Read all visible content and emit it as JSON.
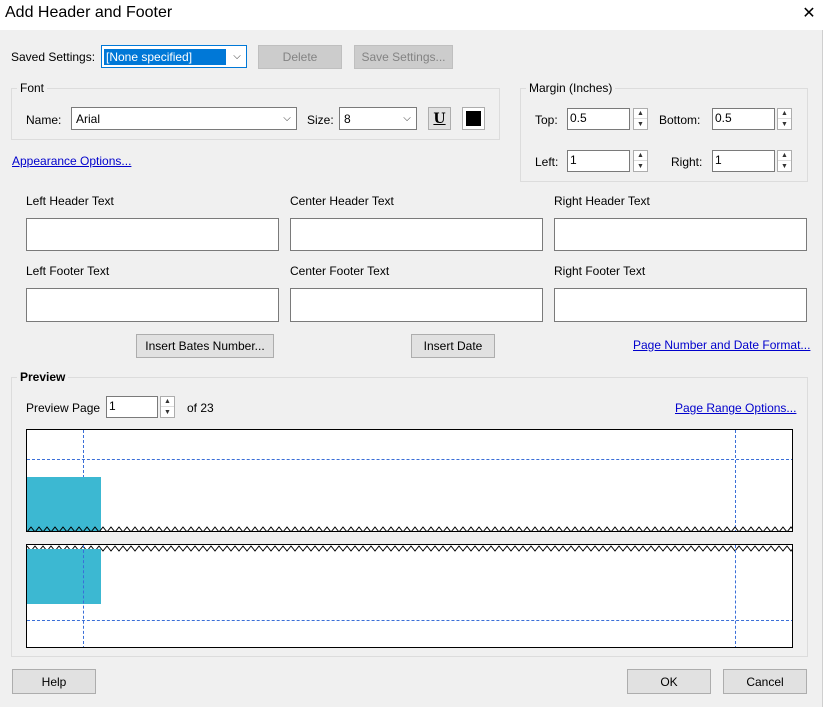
{
  "window": {
    "title": "Add Header and Footer",
    "close_glyph": "✕"
  },
  "saved_settings": {
    "label": "Saved Settings:",
    "value": "[None specified]",
    "delete_label": "Delete",
    "save_label": "Save Settings..."
  },
  "font": {
    "group_label": "Font",
    "name_label": "Name:",
    "name_value": "Arial",
    "size_label": "Size:",
    "size_value": "8",
    "underline_glyph": "U",
    "color": "#000000"
  },
  "margin": {
    "group_label": "Margin (Inches)",
    "top_label": "Top:",
    "top_value": "0.5",
    "bottom_label": "Bottom:",
    "bottom_value": "0.5",
    "left_label": "Left:",
    "left_value": "1",
    "right_label": "Right:",
    "right_value": "1"
  },
  "appearance_link": "Appearance Options...",
  "header_text": {
    "left_label": "Left Header Text",
    "center_label": "Center Header Text",
    "right_label": "Right Header Text",
    "left_value": "",
    "center_value": "",
    "right_value": ""
  },
  "footer_text": {
    "left_label": "Left Footer Text",
    "center_label": "Center Footer Text",
    "right_label": "Right Footer Text",
    "left_value": "",
    "center_value": "",
    "right_value": ""
  },
  "insert_bates_label": "Insert Bates Number...",
  "insert_date_label": "Insert Date",
  "page_number_format_link": "Page Number and Date Format...",
  "preview": {
    "group_label": "Preview",
    "page_label": "Preview Page",
    "page_value": "1",
    "of_text": "of 23",
    "range_link": "Page Range Options...",
    "accent_color": "#3cb8d2"
  },
  "footer_buttons": {
    "help_label": "Help",
    "ok_label": "OK",
    "cancel_label": "Cancel"
  }
}
